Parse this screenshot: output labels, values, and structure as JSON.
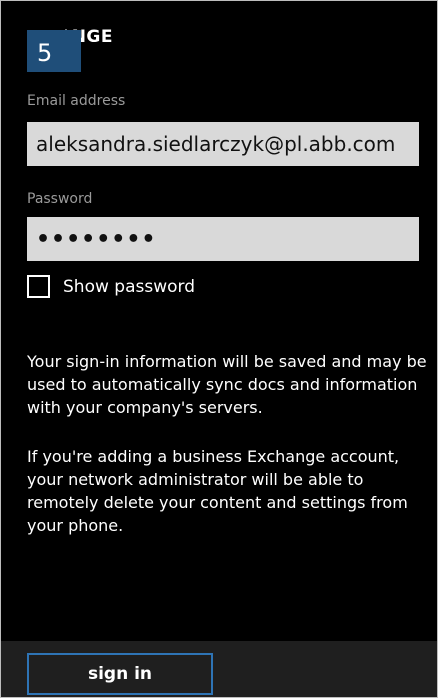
{
  "header": {
    "title_partial": "\\NGE",
    "step_number": "5"
  },
  "form": {
    "email_label": "Email address",
    "email_value": "aleksandra.siedlarczyk@pl.abb.com",
    "password_label": "Password",
    "password_value": "••••••••",
    "show_password_label": "Show password",
    "show_password_checked": false
  },
  "info": {
    "paragraph_1": "Your sign-in information will be saved and may be used to automatically sync docs and information with your company's servers.",
    "paragraph_2": "If you're adding a business Exchange account, your network administrator will be able to remotely delete your content and settings from your phone."
  },
  "app_bar": {
    "sign_in_label": "sign in"
  },
  "colors": {
    "background": "#000000",
    "field_background": "#d9d9d9",
    "label_gray": "#9a9a9a",
    "badge_blue": "#1f4e79",
    "button_border_blue": "#2e74b5",
    "app_bar": "#1f1f1f"
  }
}
